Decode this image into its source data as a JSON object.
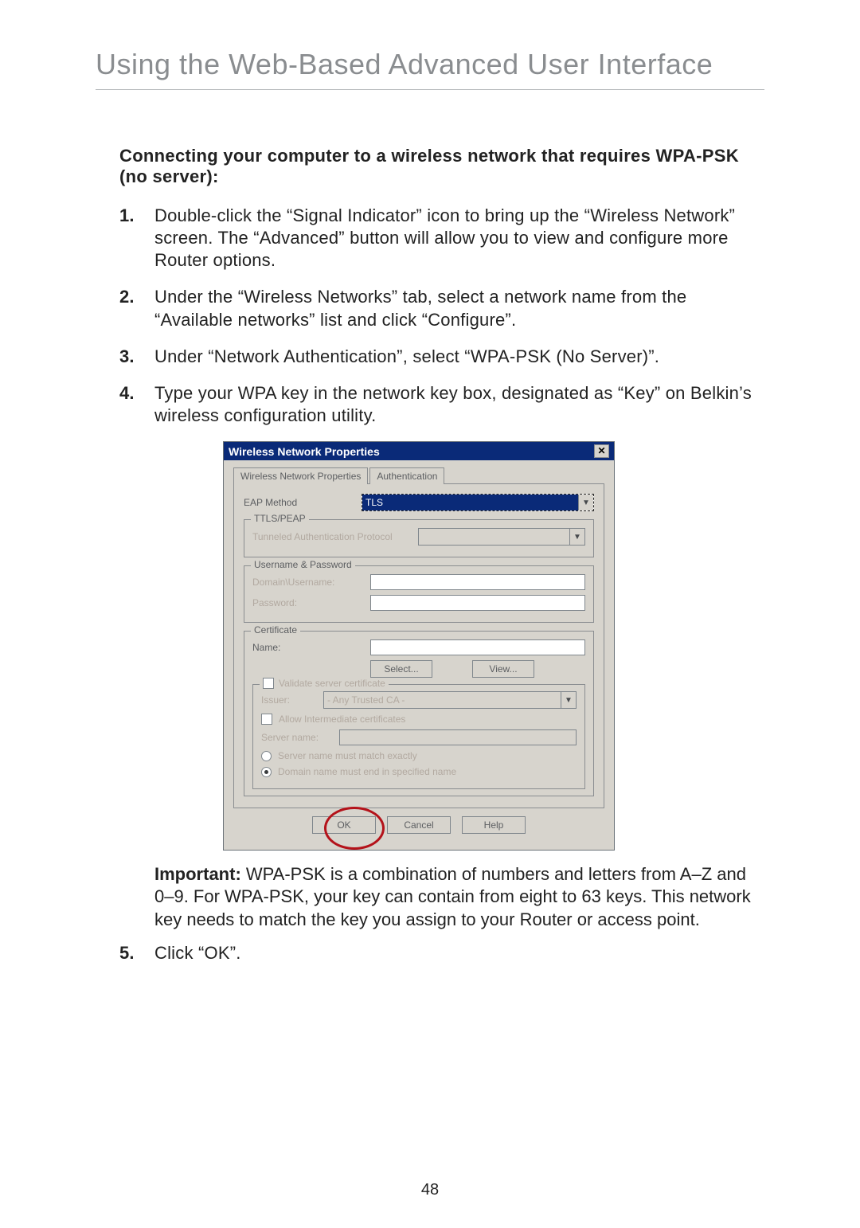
{
  "title": "Using the Web-Based Advanced User Interface",
  "subheading": "Connecting your computer to a wireless network that requires WPA-PSK (no server):",
  "steps": {
    "n1": "1.",
    "t1": "Double-click the “Signal Indicator” icon to bring up the “Wireless Network” screen. The “Advanced” button will allow you to view and configure more Router options.",
    "n2": "2.",
    "t2": "Under the “Wireless Networks” tab, select a network name from the “Available networks” list and click “Configure”.",
    "n3": "3.",
    "t3": "Under “Network Authentication”, select “WPA-PSK (No Server)”.",
    "n4": "4.",
    "t4": "Type your WPA key in the network key box, designated as “Key” on Belkin’s wireless configuration utility.",
    "n5": "5.",
    "t5": "Click “OK”."
  },
  "important": {
    "label": "Important:",
    "text": " WPA-PSK is a combination of numbers and letters from A–Z and 0–9. For WPA-PSK, your key can contain from eight to 63 keys. This network key needs to match the key you assign to your Router or access point."
  },
  "dialog": {
    "title": "Wireless Network Properties",
    "tabs": {
      "t1": "Wireless Network Properties",
      "t2": "Authentication"
    },
    "eap_label": "EAP Method",
    "eap_value": "TLS",
    "ttls": {
      "legend": "TTLS/PEAP",
      "tap_label": "Tunneled Authentication Protocol"
    },
    "userpass": {
      "legend": "Username & Password",
      "user_label": "Domain\\Username:",
      "pass_label": "Password:"
    },
    "cert": {
      "legend": "Certificate",
      "name_label": "Name:",
      "select_btn": "Select...",
      "view_btn": "View..."
    },
    "validate": {
      "legend": "Validate server certificate",
      "issuer_label": "Issuer:",
      "issuer_value": "- Any Trusted CA -",
      "allow_label": "Allow Intermediate certificates",
      "server_label": "Server name:",
      "r1": "Server name must match exactly",
      "r2": "Domain name must end in specified name"
    },
    "buttons": {
      "ok": "OK",
      "cancel": "Cancel",
      "help": "Help"
    }
  },
  "page_number": "48"
}
